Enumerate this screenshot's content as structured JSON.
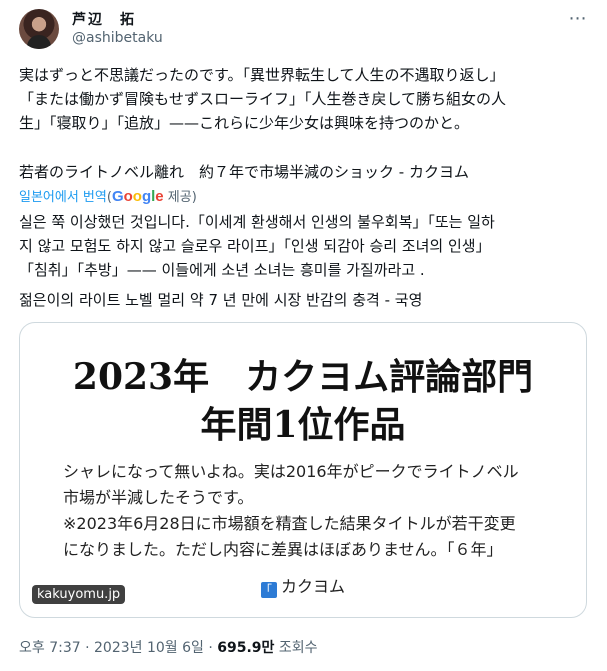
{
  "author": {
    "name": "芦辺　拓",
    "handle": "@ashibetaku"
  },
  "more_icon": "⋯",
  "tweet": {
    "jp_text": "実はずっと不思議だったのです。「異世界転生して人生の不遇取り返し」\n「または働かず冒険もせずスローライフ」「人生巻き戻して勝ち組女の人\n生」「寝取り」「追放」——これらに少年少女は興味を持つのかと。",
    "jp_link_title": "若者のライトノベル離れ　約７年で市場半減のショック - カクヨム",
    "translate_link": "일본어에서 번역",
    "translate_open": "(",
    "google_letters": [
      "G",
      "o",
      "o",
      "g",
      "l",
      "e"
    ],
    "translate_provided": " 제공)",
    "ko_text": "실은 쭉 이상했던 것입니다.「이세계 환생해서 인생의 불우회복」「또는 일하\n지 않고 모험도 하지 않고 슬로우 라이프」「인생 되감아 승리 조녀의 인생」\n「침취」「추방」—— 이들에게 소년 소녀는 흥미를 가질까라고 .",
    "ko_link_title": "젊은이의 라이트 노벨 멀리 약 7 년 만에 시장 반감의 충격 - 국영"
  },
  "card": {
    "headline_line1": "2023年　カクヨム評論部門",
    "headline_line2": "年間1位作品",
    "body": "シャレになって無いよね。実は2016年がピークでライトノベル\n市場が半減したそうです。\n※2023年6月28日に市場額を精査した結果タイトルが若干変更\nになりました。ただし内容に差異はほぼありません。「６年」",
    "logo_mark": "｢",
    "logo_text": "カクヨム",
    "domain": "kakuyomu.jp"
  },
  "meta": {
    "time": "오후 7:37 · 2023년 10월 6일 · ",
    "views": "695.9만",
    "views_label": " 조회수"
  }
}
